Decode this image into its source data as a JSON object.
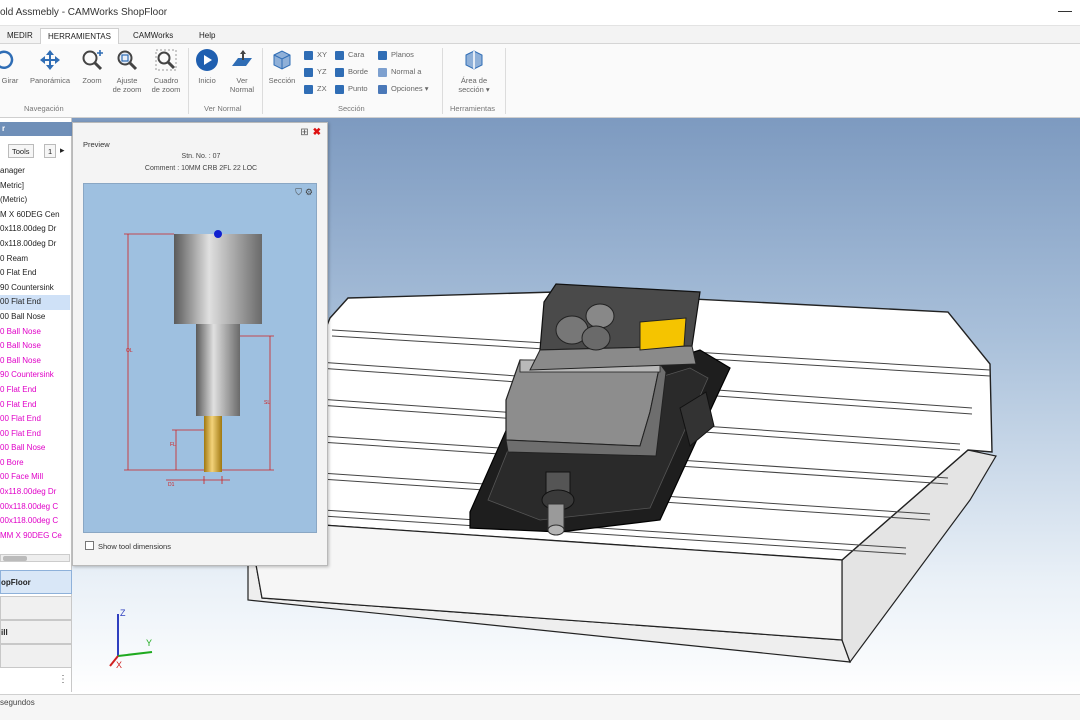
{
  "window": {
    "title": "old Assmebly - CAMWorks ShopFloor"
  },
  "tabs": [
    {
      "label": "MEDIR",
      "active": false
    },
    {
      "label": "HERRAMIENTAS",
      "active": true
    },
    {
      "label": "CAMWorks",
      "active": false
    },
    {
      "label": "Help",
      "active": false
    }
  ],
  "ribbon": {
    "navegacion": {
      "label": "Navegación",
      "buttons": [
        {
          "label": "Girar",
          "icon": "rotate-icon"
        },
        {
          "label": "Panorámica",
          "icon": "pan-icon"
        },
        {
          "label": "Zoom",
          "icon": "zoom-icon"
        },
        {
          "label": "Ajuste de zoom",
          "label1": "Ajuste",
          "label2": "de zoom",
          "icon": "zoom-fit-icon"
        },
        {
          "label": "Cuadro de zoom",
          "label1": "Cuadro",
          "label2": "de zoom",
          "icon": "zoom-box-icon"
        }
      ]
    },
    "vernormal": {
      "label": "Ver Normal",
      "buttons": [
        {
          "label": "Inicio",
          "icon": "home-play-icon"
        },
        {
          "label": "Ver Normal",
          "label1": "Ver",
          "label2": "Normal",
          "icon": "view-normal-icon"
        }
      ]
    },
    "seccion": {
      "label": "Sección",
      "big_label": "Sección",
      "small": [
        "XY",
        "YZ",
        "ZX",
        "Cara",
        "Borde",
        "Punto",
        "Planos",
        "Normal a",
        "Opciones"
      ]
    },
    "herramientas": {
      "label": "Herramientas",
      "big_label1": "Área de",
      "big_label2": "sección"
    }
  },
  "left_panel": {
    "tabs": [
      "Tools",
      "1"
    ],
    "tree": [
      {
        "text": "anager",
        "color": "black"
      },
      {
        "text": "Metric]",
        "color": "black"
      },
      {
        "text": "(Metric)",
        "color": "black"
      },
      {
        "text": "M X 60DEG Cen",
        "color": "black"
      },
      {
        "text": "0x118.00deg Dr",
        "color": "black"
      },
      {
        "text": "0x118.00deg Dr",
        "color": "black"
      },
      {
        "text": "0 Ream",
        "color": "black"
      },
      {
        "text": "0 Flat End",
        "color": "black"
      },
      {
        "text": "90 Countersink",
        "color": "black"
      },
      {
        "text": "00 Flat End",
        "color": "black",
        "selected": true
      },
      {
        "text": "00 Ball Nose",
        "color": "black"
      },
      {
        "text": "0 Ball Nose",
        "color": "pink"
      },
      {
        "text": "0 Ball Nose",
        "color": "pink"
      },
      {
        "text": "0 Ball Nose",
        "color": "pink"
      },
      {
        "text": "90 Countersink",
        "color": "pink"
      },
      {
        "text": "0 Flat End",
        "color": "pink"
      },
      {
        "text": "0 Flat End",
        "color": "pink"
      },
      {
        "text": "00 Flat End",
        "color": "pink"
      },
      {
        "text": "00 Flat End",
        "color": "pink"
      },
      {
        "text": "00 Ball Nose",
        "color": "pink"
      },
      {
        "text": "0 Bore",
        "color": "pink"
      },
      {
        "text": "00 Face Mill",
        "color": "pink"
      },
      {
        "text": "0x118.00deg Dr",
        "color": "pink"
      },
      {
        "text": "00x118.00deg C",
        "color": "pink"
      },
      {
        "text": "00x118.00deg C",
        "color": "pink"
      },
      {
        "text": "MM X 90DEG Ce",
        "color": "pink"
      }
    ],
    "nav_buttons": [
      "opFloor",
      "",
      "ill",
      ""
    ]
  },
  "preview": {
    "title": "Preview",
    "stn_label": "Stn. No. : 07",
    "comment_label": "Comment : 10MM CRB 2FL 22 LOC",
    "show_dims_label": "Show tool dimensions"
  },
  "status": {
    "text": "segundos"
  },
  "colors": {
    "accent": "#2f6db5",
    "pink_text": "#e000c8",
    "yellow_block": "#f5c400",
    "viewport_top": "#7d9ac0"
  }
}
